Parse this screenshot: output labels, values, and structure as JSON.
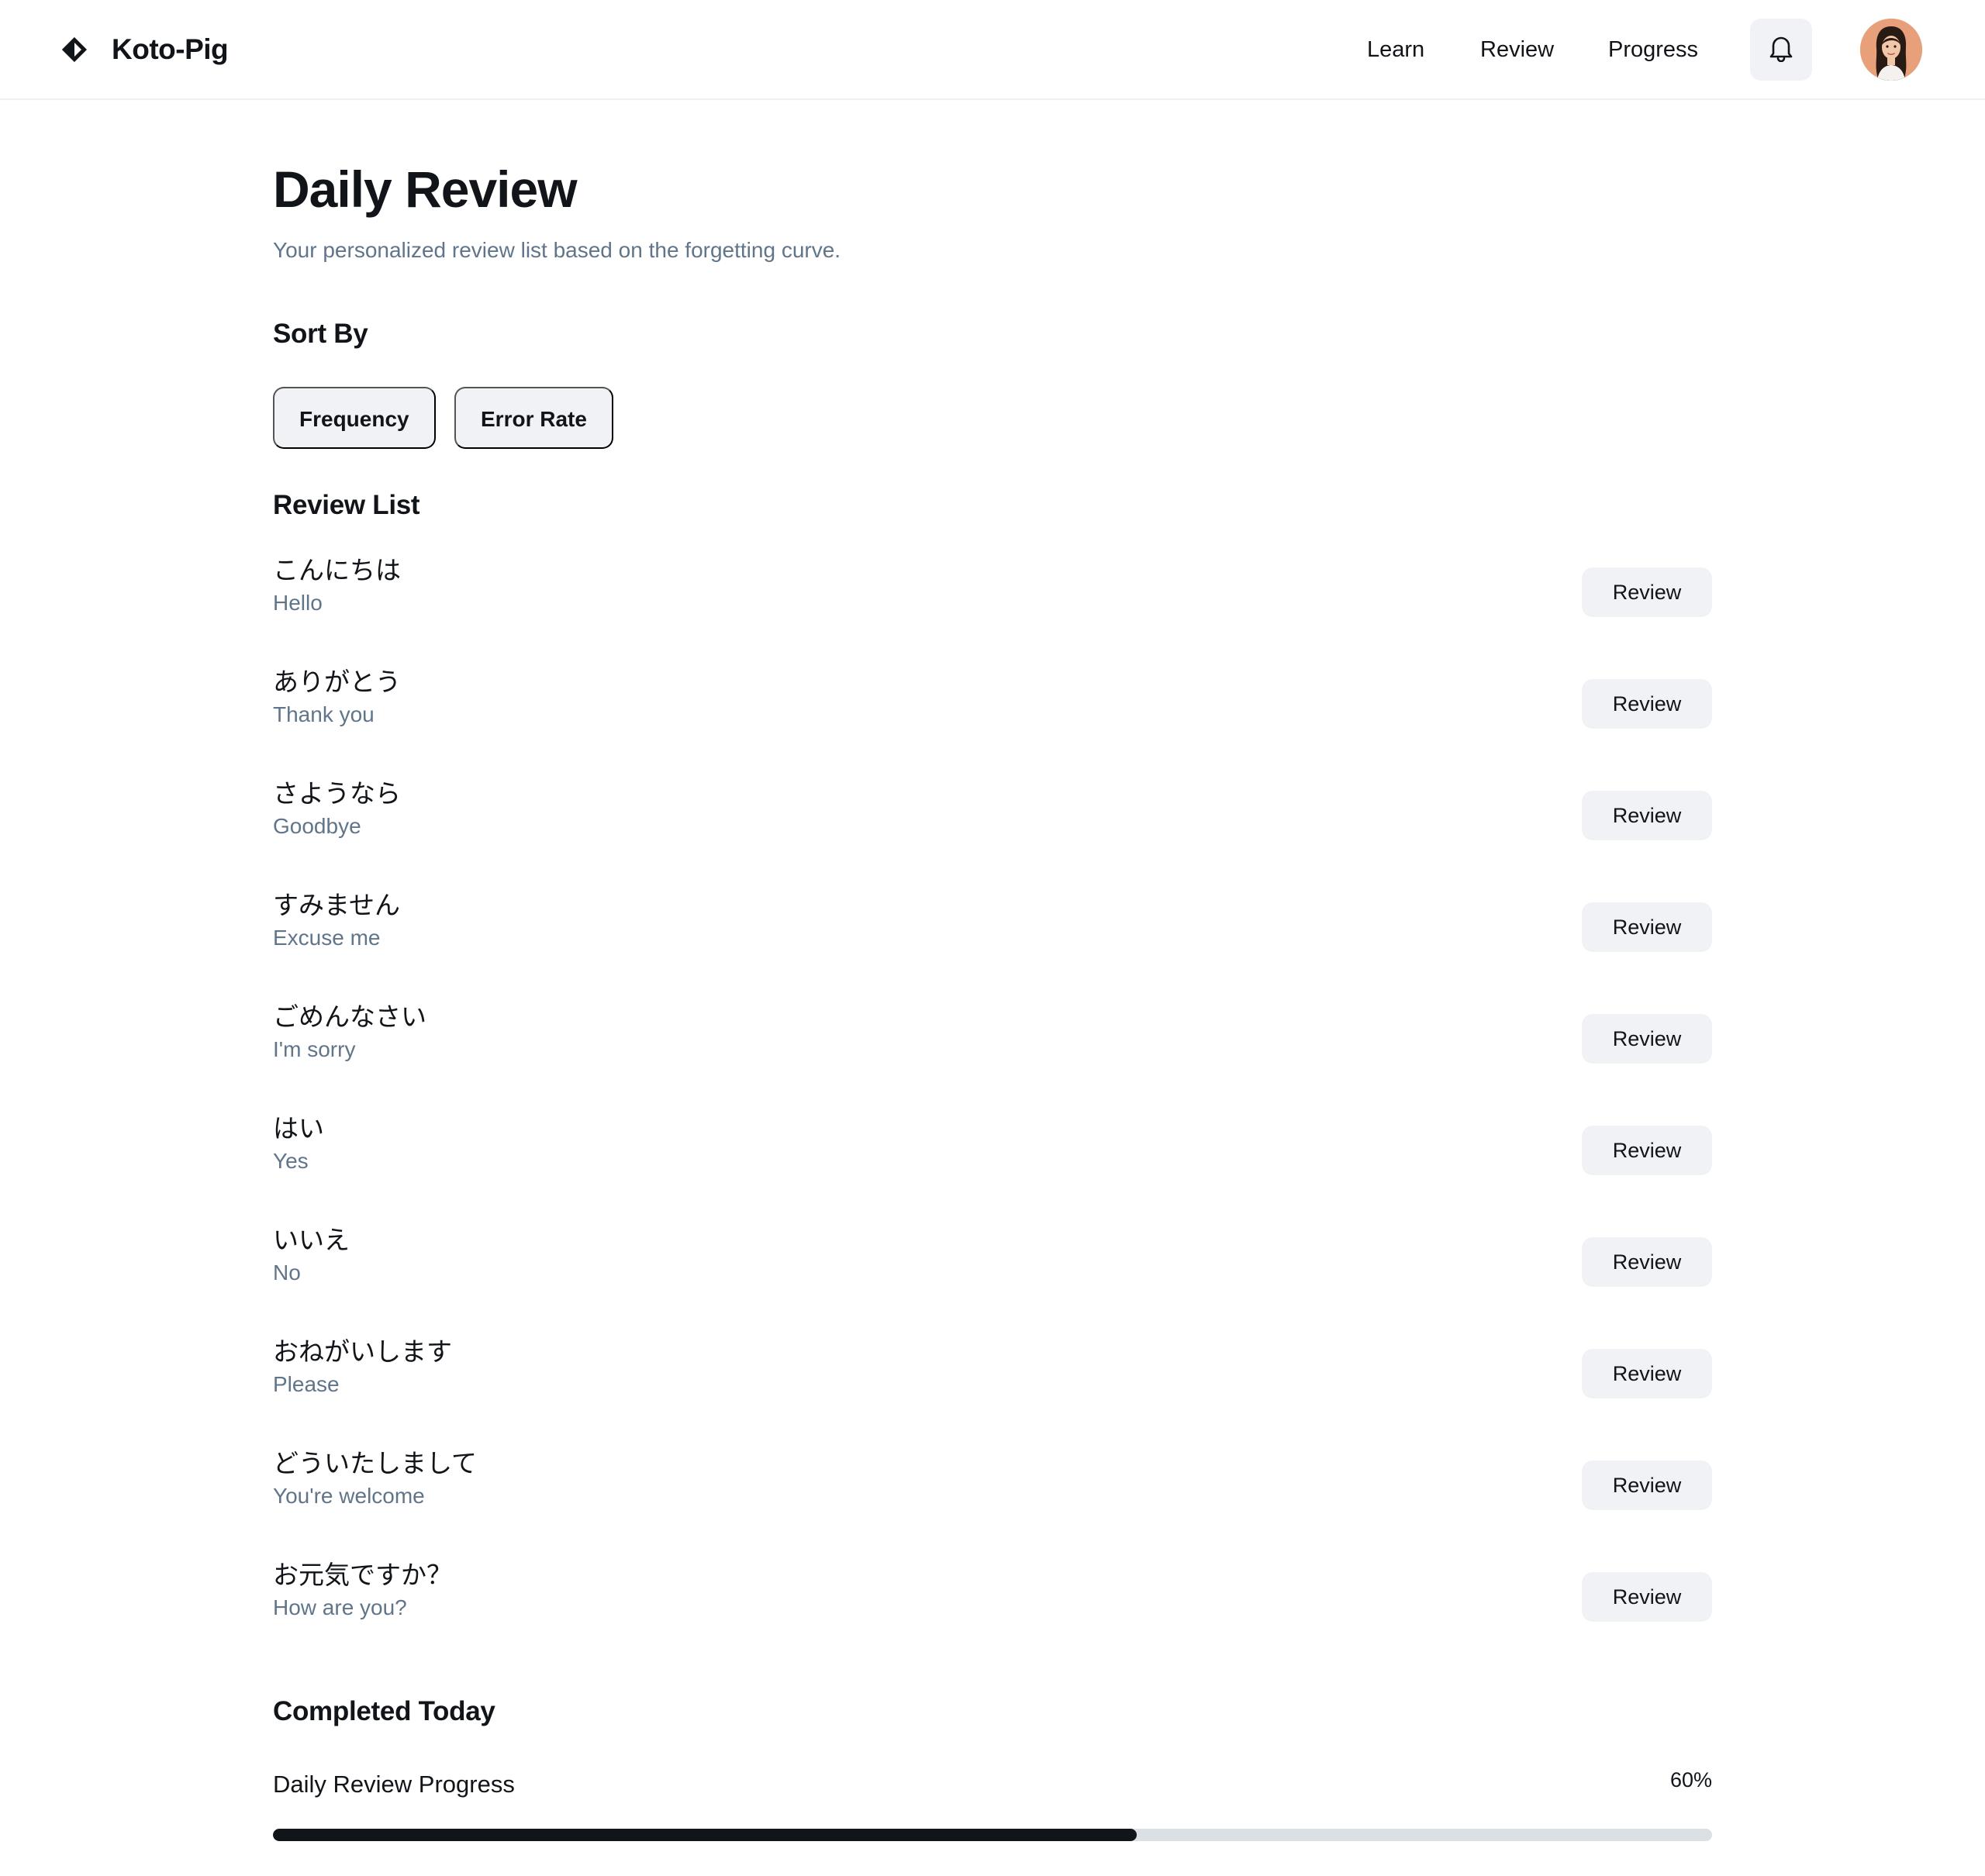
{
  "header": {
    "brand_name": "Koto-Pig",
    "logo_icon": "diamond-logo-icon",
    "nav": {
      "learn": "Learn",
      "review": "Review",
      "progress": "Progress"
    },
    "notification_icon": "bell-icon",
    "avatar_icon": "user-avatar"
  },
  "main": {
    "title": "Daily Review",
    "subtitle": "Your personalized review list based on the forgetting curve.",
    "sort": {
      "heading": "Sort By",
      "options": [
        "Frequency",
        "Error Rate"
      ]
    },
    "review_list": {
      "heading": "Review List",
      "button_label": "Review",
      "items": [
        {
          "jp": "こんにちは",
          "en": "Hello"
        },
        {
          "jp": "ありがとう",
          "en": "Thank you"
        },
        {
          "jp": "さようなら",
          "en": "Goodbye"
        },
        {
          "jp": "すみません",
          "en": "Excuse me"
        },
        {
          "jp": "ごめんなさい",
          "en": "I'm sorry"
        },
        {
          "jp": "はい",
          "en": "Yes"
        },
        {
          "jp": "いいえ",
          "en": "No"
        },
        {
          "jp": "おねがいします",
          "en": "Please"
        },
        {
          "jp": "どういたしまして",
          "en": "You're welcome"
        },
        {
          "jp": "お元気ですか？",
          "en": "How are you?"
        }
      ]
    },
    "completed": {
      "heading": "Completed Today",
      "progress_label": "Daily Review Progress",
      "progress_text": "60%",
      "progress_value": 0.6
    }
  },
  "colors": {
    "text_primary": "#111418",
    "text_secondary": "#60758a",
    "chip_bg": "#f0f2f5",
    "progress_track": "#dbe0e5",
    "progress_fill": "#111418",
    "avatar_bg": "#e7a07a"
  }
}
